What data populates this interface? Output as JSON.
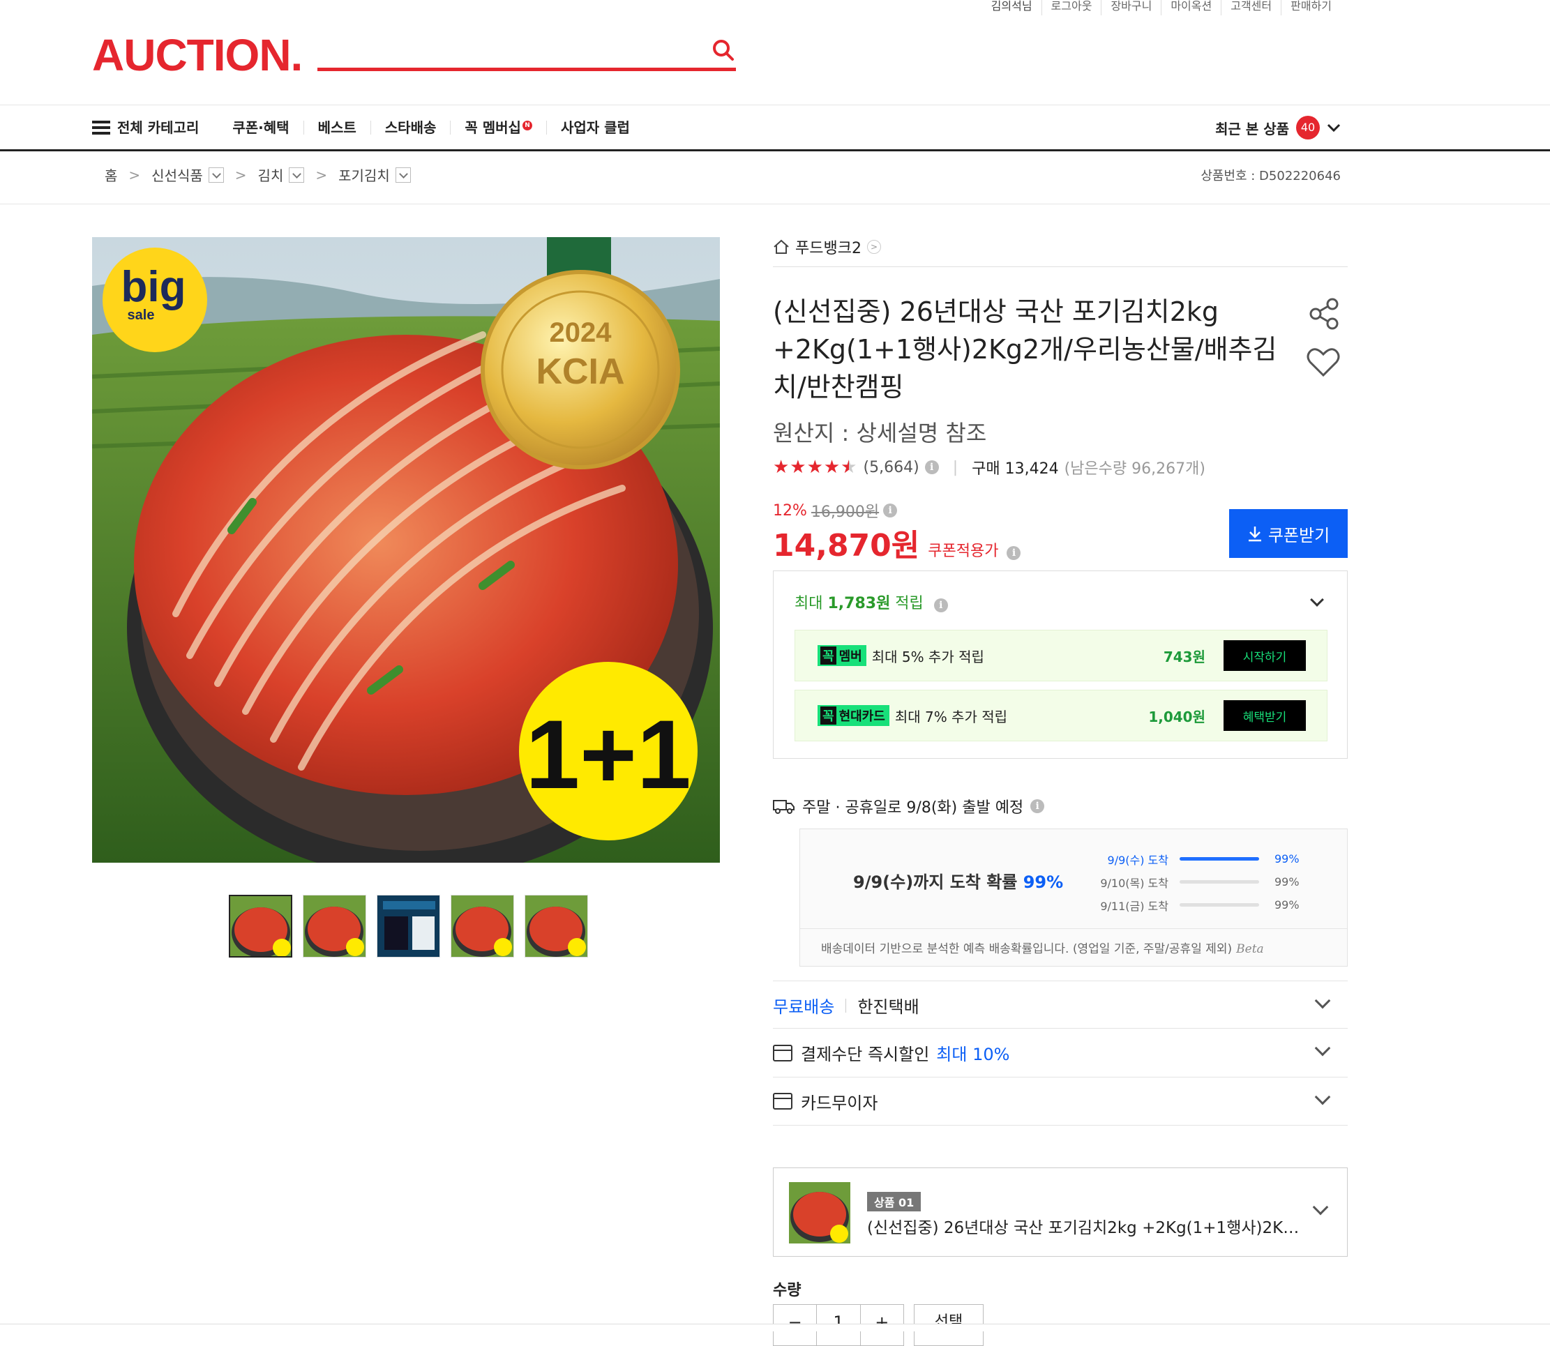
{
  "util": {
    "links": [
      "김의석님",
      "로그아웃",
      "장바구니",
      "마이옥션",
      "고객센터",
      "판매하기"
    ]
  },
  "header": {
    "logo": "AUCTION."
  },
  "nav": {
    "all_category": "전체 카테고리",
    "items": [
      "쿠폰·혜택",
      "베스트",
      "스타배송",
      "꼭 멤버십",
      "사업자 클럽"
    ],
    "membership_badge": "N",
    "recent_label": "최근 본 상품",
    "recent_count": "40"
  },
  "breadcrumb": {
    "home": "홈",
    "items": [
      "신선식품",
      "김치",
      "포기김치"
    ],
    "product_no": "상품번호 : D502220646"
  },
  "gallery": {
    "badge_big": "big",
    "badge_sale": "sale",
    "medal_year": "2024",
    "medal_text": "KCIA",
    "one_plus_one": "1+1",
    "thumb_count": 5
  },
  "product": {
    "seller": "푸드뱅크2",
    "title": "(신선집중) 26년대상 국산 포기김치2kg +2Kg(1+1행사)2Kg2개/우리농산물/배추김치/반찬캠핑",
    "origin": "원산지 : 상세설명 참조",
    "rating_stars": 4.5,
    "review_count": "(5,664)",
    "purchase": "구매 13,424",
    "stock": "(남은수량 96,267개)",
    "discount_pct": "12%",
    "original_price": "16,900원",
    "price": "14,870원",
    "price_label": "쿠폰적용가",
    "coupon_button": "쿠폰받기"
  },
  "reward": {
    "head_prefix": "최대 ",
    "head_amount": "1,783원",
    "head_suffix": " 적립",
    "rows": [
      {
        "tag_k": "꼭",
        "tag": "멤버",
        "text": "최대 5% 추가 적립",
        "amount": "743원",
        "button": "시작하기"
      },
      {
        "tag_k": "꼭",
        "tag": "현대카드",
        "text": "최대 7% 추가 적립",
        "amount": "1,040원",
        "button": "혜택받기"
      }
    ]
  },
  "delivery": {
    "ship_text": "주말 · 공휴일로 9/8(화) 출발 예정",
    "main_prefix": "9/9(수)까지 도착 확률 ",
    "main_pct": "99%",
    "lines": [
      {
        "date": "9/9(수) 도착",
        "pct": "99%",
        "active": true,
        "fill": 1.0
      },
      {
        "date": "9/10(목) 도착",
        "pct": "99%",
        "active": false,
        "fill": 0
      },
      {
        "date": "9/11(금) 도착",
        "pct": "99%",
        "active": false,
        "fill": 0
      }
    ],
    "note": "배송데이터 기반으로 분석한 예측 배송확률입니다. (영업일 기준, 주말/공휴일 제외)",
    "beta": "Beta"
  },
  "accordions": {
    "free_shipping": "무료배송",
    "courier": "한진택배",
    "payment_label": "결제수단 즉시할인",
    "payment_highlight": "최대 10%",
    "card_label": "카드무이자"
  },
  "option": {
    "badge": "상품 01",
    "name": "(신선집중) 26년대상 국산 포기김치2kg +2Kg(1+1행사)2Kg2개..."
  },
  "quantity": {
    "label": "수량",
    "minus": "−",
    "value": "1",
    "plus": "+",
    "select": "선택"
  },
  "colors": {
    "brand_red": "#e5262e",
    "blue": "#0c5ff5",
    "green": "#18e07a"
  }
}
